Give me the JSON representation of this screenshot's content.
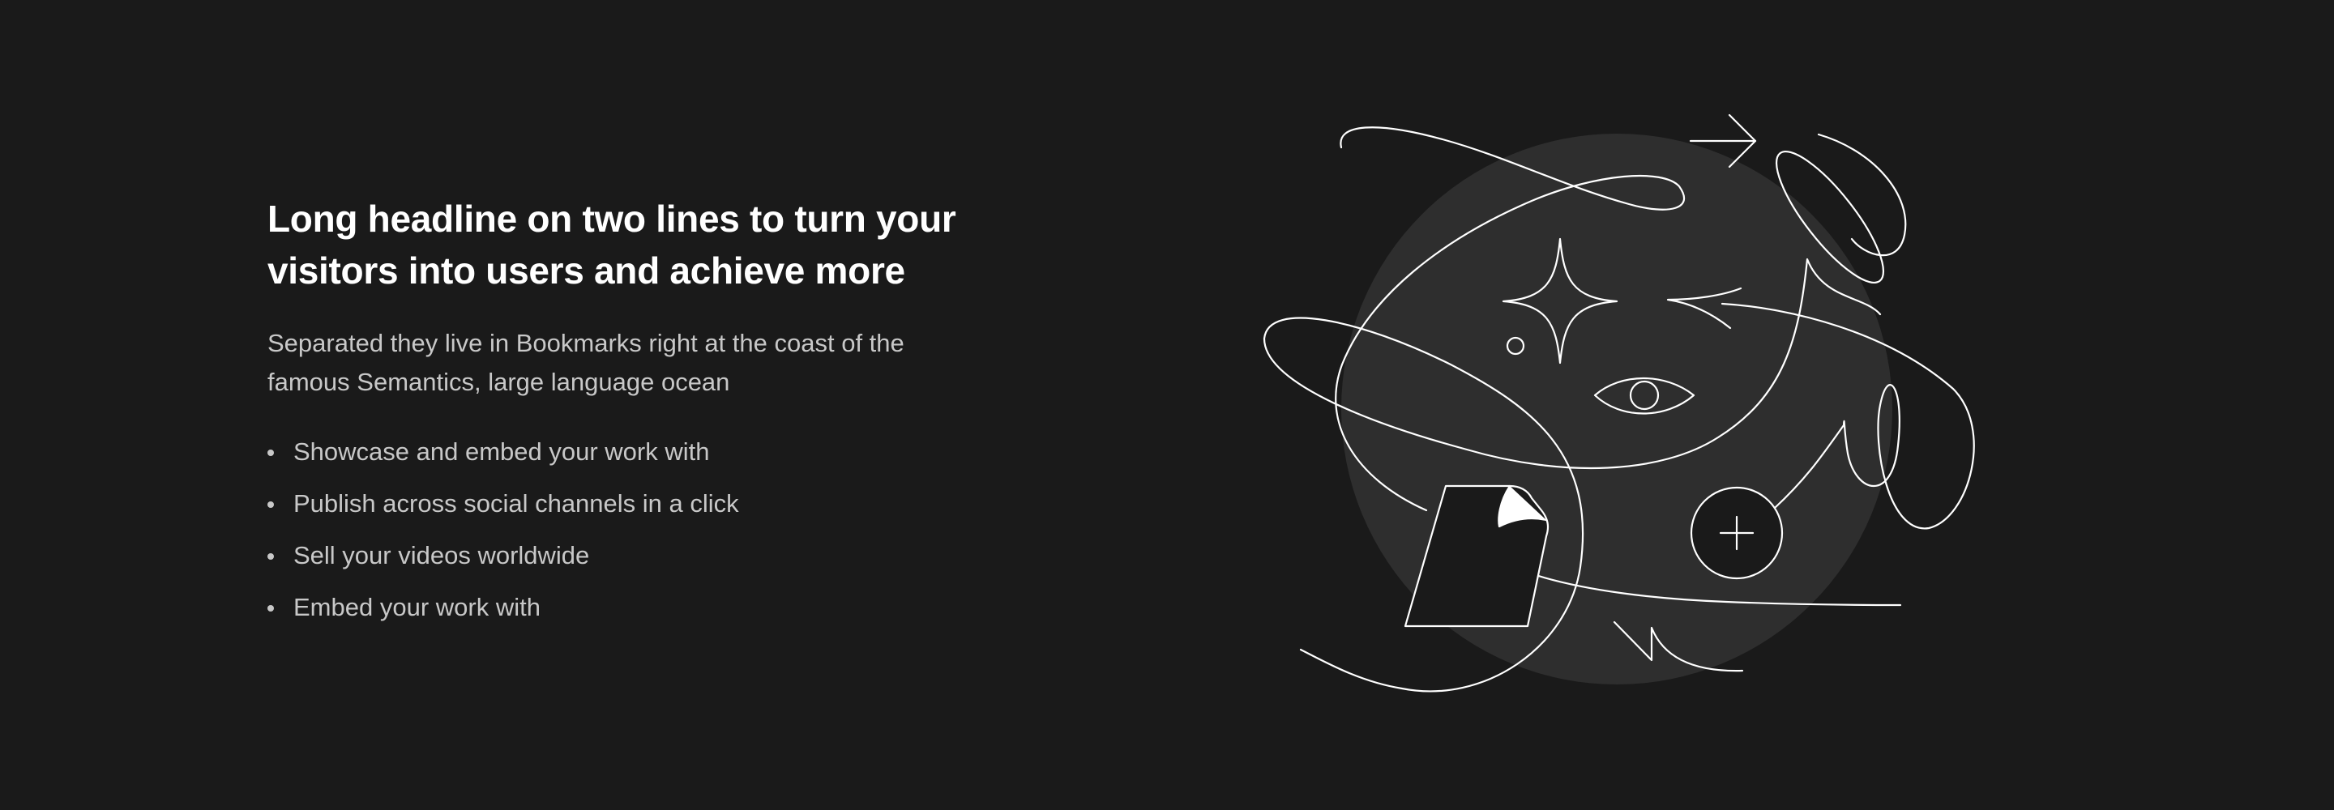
{
  "hero": {
    "headline_line1": "Long headline on two lines to turn your",
    "headline_line2": "visitors into users and achieve more",
    "subtitle_line1": "Separated they live in Bookmarks right at the coast of the",
    "subtitle_line2": "famous Semantics, large language ocean",
    "bullets": [
      "Showcase and embed your work with",
      "Publish across social channels in a click",
      "Sell your videos worldwide",
      "Embed your work with"
    ]
  },
  "illustration": {
    "icons": [
      "sparkle-icon",
      "eye-icon",
      "plus-circle-icon",
      "document-icon",
      "arrow-right-icon"
    ]
  },
  "colors": {
    "background": "#1a1a1a",
    "headline": "#ffffff",
    "body_text": "#c8c8c8",
    "circle": "#2e2e2e",
    "stroke": "#ffffff"
  }
}
